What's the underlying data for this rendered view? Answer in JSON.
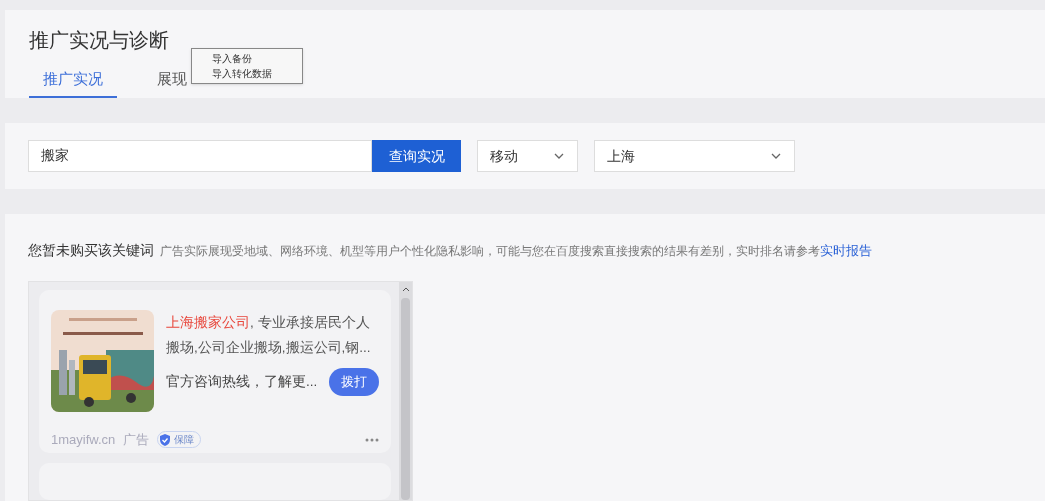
{
  "page_title": "推广实况与诊断",
  "tabs": [
    {
      "label": "推广实况",
      "selected": true
    },
    {
      "label": "展现",
      "selected": false
    }
  ],
  "context_menu": {
    "items": [
      "导入备份",
      "导入转化数据"
    ]
  },
  "search": {
    "value": "搬家",
    "button": "查询实况",
    "device": "移动",
    "region": "上海"
  },
  "notice": {
    "title": "您暂未购买该关键词",
    "text": "广告实际展现受地域、网络环境、机型等用户个性化隐私影响，可能与您在百度搜索直接搜索的结果有差别，实时排名请参考",
    "link": "实时报告"
  },
  "ad": {
    "highlight": "上海搬家公司",
    "description": ", 专业承接居民个人搬场,公司企业搬场,搬运公司,钢...",
    "hotline": "官方咨询热线，了解更...",
    "call_button": "拨打",
    "domain": "1mayifw.cn",
    "ad_label": "广告",
    "badge": "保障"
  }
}
